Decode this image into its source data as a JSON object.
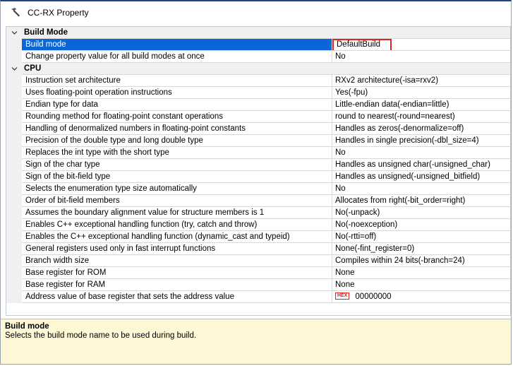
{
  "window": {
    "title": "CC-RX Property"
  },
  "categories": [
    {
      "label": "Build Mode",
      "rows": [
        {
          "name": "Build mode",
          "value": "DefaultBuild",
          "selected": true
        },
        {
          "name": "Change property value for all build modes at once",
          "value": "No"
        }
      ]
    },
    {
      "label": "CPU",
      "rows": [
        {
          "name": "Instruction set architecture",
          "value": "RXv2 architecture(-isa=rxv2)"
        },
        {
          "name": "Uses floating-point operation instructions",
          "value": "Yes(-fpu)"
        },
        {
          "name": "Endian type for data",
          "value": "Little-endian data(-endian=little)"
        },
        {
          "name": "Rounding method for floating-point constant operations",
          "value": "round to nearest(-round=nearest)"
        },
        {
          "name": "Handling of denormalized numbers in floating-point constants",
          "value": "Handles as zeros(-denormalize=off)"
        },
        {
          "name": "Precision of the double type and long double type",
          "value": "Handles in single precision(-dbl_size=4)"
        },
        {
          "name": "Replaces the int type with the short type",
          "value": "No"
        },
        {
          "name": "Sign of the char type",
          "value": "Handles as unsigned char(-unsigned_char)"
        },
        {
          "name": "Sign of the bit-field type",
          "value": "Handles as unsigned(-unsigned_bitfield)"
        },
        {
          "name": "Selects the enumeration type size automatically",
          "value": "No"
        },
        {
          "name": "Order of bit-field members",
          "value": "Allocates from right(-bit_order=right)"
        },
        {
          "name": "Assumes the boundary alignment value for structure members is 1",
          "value": "No(-unpack)"
        },
        {
          "name": "Enables C++ exceptional handling function (try, catch and throw)",
          "value": "No(-noexception)"
        },
        {
          "name": "Enables the C++ exceptional handling function (dynamic_cast and typeid)",
          "value": "No(-rtti=off)"
        },
        {
          "name": "General registers used only in fast interrupt functions",
          "value": "None(-fint_register=0)"
        },
        {
          "name": "Branch width size",
          "value": "Compiles within 24 bits(-branch=24)"
        },
        {
          "name": "Base register for ROM",
          "value": "None"
        },
        {
          "name": "Base register for RAM",
          "value": "None"
        },
        {
          "name": "Address value of base register that sets the address value",
          "value": "00000000",
          "badge": "HEX"
        }
      ]
    }
  ],
  "description": {
    "title": "Build mode",
    "text": "Selects the build mode name to be used during build."
  },
  "colors": {
    "selection": "#0a66d6",
    "highlight_box": "#e02424",
    "description_bg": "#fdf7d6"
  },
  "icons": {
    "title": "hammer-icon",
    "collapse": "chevron-down-icon"
  }
}
